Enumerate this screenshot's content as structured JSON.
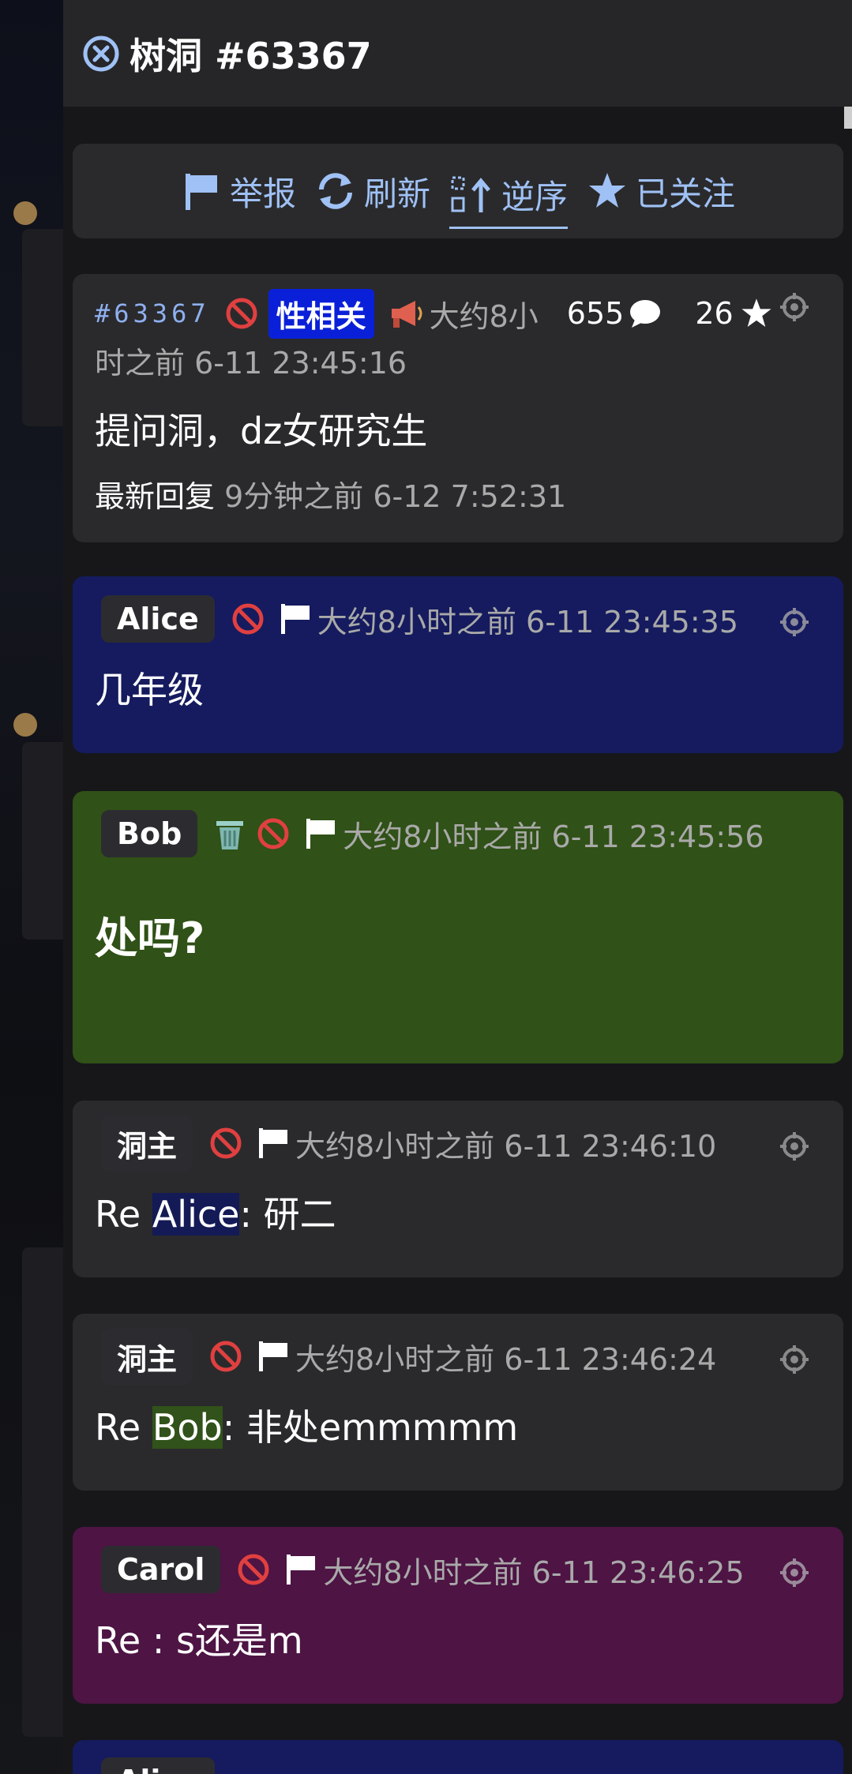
{
  "header": {
    "title": "树洞 #63367"
  },
  "toolbar": {
    "report": "举报",
    "refresh": "刷新",
    "reverse": "逆序",
    "followed": "已关注"
  },
  "main_post": {
    "id": "#63367",
    "tag": "性相关",
    "time_line1": "大约8小",
    "time_line2": "时之前 6-11 23:45:16",
    "reply_count": "655",
    "star_count": "26",
    "content": "提问洞，dz女研究生",
    "latest_label": "最新回复",
    "latest_time": "9分钟之前 6-12 7:52:31"
  },
  "replies": [
    {
      "name": "Alice",
      "time": "大约8小时之前 6-11 23:45:35",
      "content": "几年级",
      "color": "#151b5e"
    },
    {
      "name": "Bob",
      "time": "大约8小时之前 6-11 23:45:56",
      "content": "处吗?",
      "color": "#305117"
    },
    {
      "name": "洞主",
      "time": "大约8小时之前 6-11 23:46:10",
      "re_prefix": "Re ",
      "re_name": "Alice",
      "re_text": ": 研二",
      "color": "#2a2a2c"
    },
    {
      "name": "洞主",
      "time": "大约8小时之前 6-11 23:46:24",
      "re_prefix": "Re ",
      "re_name": "Bob",
      "re_text": ": 非处emmmmm",
      "color": "#2a2a2c"
    },
    {
      "name": "Carol",
      "time": "大约8小时之前 6-11 23:46:25",
      "content": "Re : s还是m",
      "color": "#4d1444"
    },
    {
      "name": "Alice",
      "color": "#151b5e"
    }
  ],
  "colors": {
    "accent": "#9fc1f5",
    "tag_bg": "#0a20d8",
    "ban_red": "#e04040"
  }
}
